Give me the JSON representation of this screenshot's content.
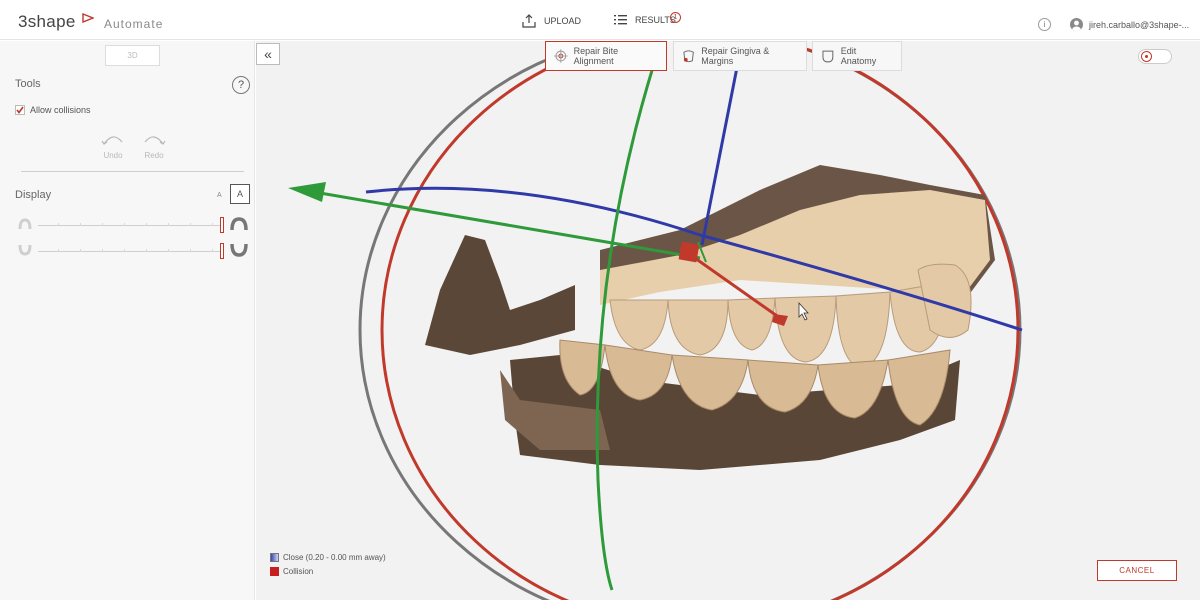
{
  "header": {
    "logo_text": "3shape",
    "app_name": "Automate",
    "upload_label": "UPLOAD",
    "results_label": "RESULTS",
    "results_count": "1",
    "user_name": "jireh.carballo@3shape-...",
    "info_symbol": "i"
  },
  "left_panel": {
    "view_mode_label": "3D",
    "tools_title": "Tools",
    "help_symbol": "?",
    "allow_collisions_label": "Allow collisions",
    "allow_collisions_checked": true,
    "undo_label": "Undo",
    "redo_label": "Redo",
    "display_title": "Display",
    "text_small_label": "A",
    "text_large_label": "A",
    "upper_jaw_opacity": 1.0,
    "lower_jaw_opacity": 1.0
  },
  "toolbar": {
    "collapse_symbol": "«",
    "buttons": [
      {
        "label": "Repair Bite Alignment",
        "icon": "target-icon",
        "active": true
      },
      {
        "label": "Repair Gingiva & Margins",
        "icon": "gingiva-icon",
        "active": false
      },
      {
        "label": "Edit Anatomy",
        "icon": "tooth-icon",
        "active": false
      }
    ],
    "collision_toggle_on": false
  },
  "legend": {
    "close_label": "Close (0.20 - 0.00 mm away)",
    "collision_label": "Collision"
  },
  "footer": {
    "cancel_label": "CANCEL"
  },
  "colors": {
    "accent": "#c0392b",
    "axis_x": "#2e9a3a",
    "axis_y": "#2f3aa8",
    "axis_z": "#c0392b",
    "gingiva": "#6b5546",
    "tooth": "#e3c9a6"
  }
}
